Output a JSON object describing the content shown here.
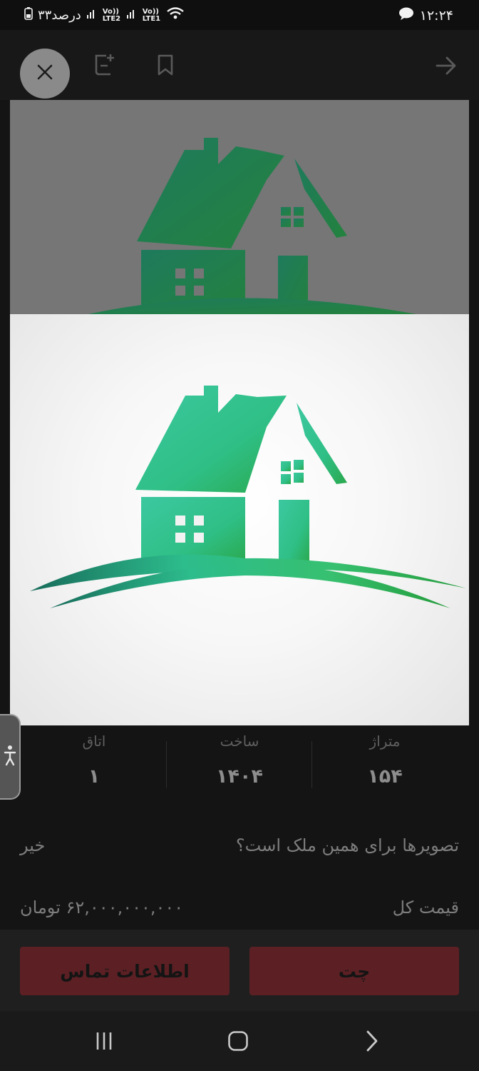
{
  "status_bar": {
    "time": "۱۲:۲۴",
    "battery": "۳۳درصد",
    "signal_labels": [
      "Vo)) LTE2",
      "Vo)) LTE1"
    ]
  },
  "top_bar": {
    "icons": [
      "back-arrow-icon",
      "bookmark-icon",
      "add-note-icon",
      "close-icon"
    ]
  },
  "stats": [
    {
      "label": "متراژ",
      "value": "۱۵۴"
    },
    {
      "label": "ساخت",
      "value": "۱۴۰۴"
    },
    {
      "label": "اتاق",
      "value": "۱"
    }
  ],
  "details": {
    "photos_question": "تصویرها برای همین ملک است؟",
    "photos_answer": "خیر",
    "total_price_label": "قیمت کل",
    "total_price_value": "۶۲,۰۰۰,۰۰۰,۰۰۰ تومان"
  },
  "actions": {
    "chat_label": "چت",
    "contact_label": "اطلاعات تماس"
  },
  "colors": {
    "accent": "#5c2024",
    "house_green": "#3cc494"
  }
}
